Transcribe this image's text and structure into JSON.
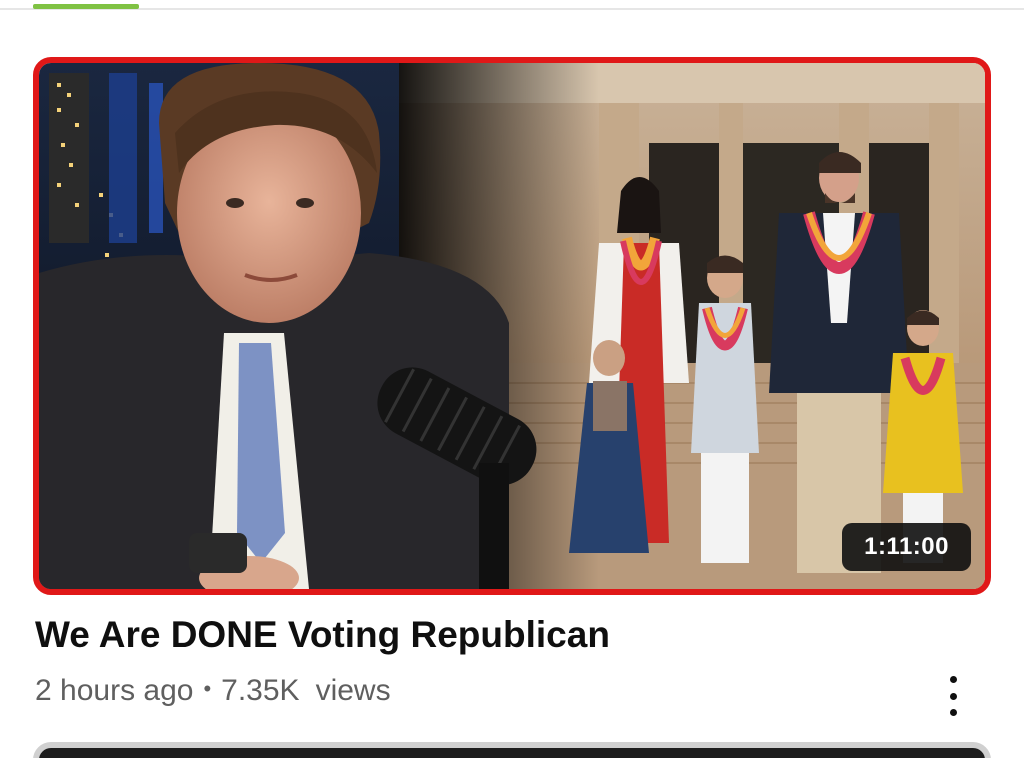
{
  "theme": {
    "accent": "#7fc243",
    "frame": "#e01818"
  },
  "video": {
    "duration": "1:11:00",
    "title": "We Are DONE Voting Republican",
    "age": "2 hours ago",
    "separator": "•",
    "views_count": "7.35K",
    "views_label": "views",
    "menu_icon": "more-vert-icon"
  }
}
